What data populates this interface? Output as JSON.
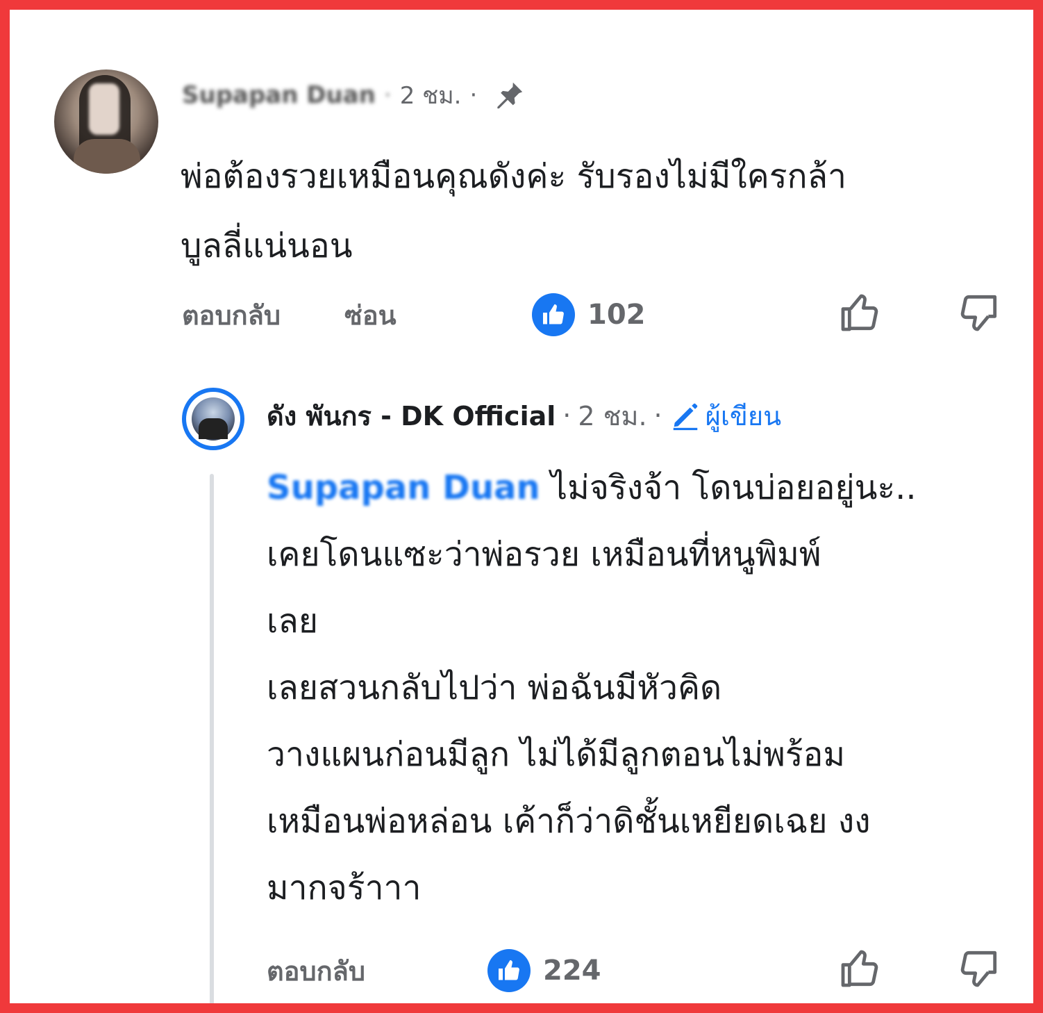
{
  "colors": {
    "border": "#f0393b",
    "accent": "#1877f2",
    "muted": "#65676b"
  },
  "comment": {
    "author": "Supapan Duan",
    "time": "2 ชม.",
    "pinned": true,
    "text_line1": "พ่อต้องรวยเหมือนคุณดังค่ะ รับรองไม่มีใครกล้า",
    "text_line2": "บูลลี่แน่นอน",
    "reply_label": "ตอบกลับ",
    "hide_label": "ซ่อน",
    "like_count": "102"
  },
  "reply": {
    "author": "ดัง พันกร - DK Official",
    "time": "2 ชม.",
    "author_badge": "ผู้เขียน",
    "mention": "Supapan Duan",
    "text_after_mention": " ไม่จริงจ้า โดนบ่อยอยู่นะ..",
    "text_rest": " เคยโดนแซะว่าพ่อรวย เหมือนที่หนูพิมพ์\nเลย\n  เลยสวนกลับไปว่า พ่อฉันมีหัวคิด\nวางแผนก่อนมีลูก ไม่ได้มีลูกตอนไม่พร้อม\nเหมือนพ่อหล่อน เค้าก็ว่าดิชั้นเหยียดเฉย งง\nมากจร้าาา",
    "reply_label": "ตอบกลับ",
    "like_count": "224"
  },
  "icons": {
    "pin": "pin-icon",
    "pencil": "pencil-icon",
    "like_badge": "thumbs-up-icon",
    "upvote": "thumbs-up-outline-icon",
    "downvote": "thumbs-down-outline-icon"
  }
}
